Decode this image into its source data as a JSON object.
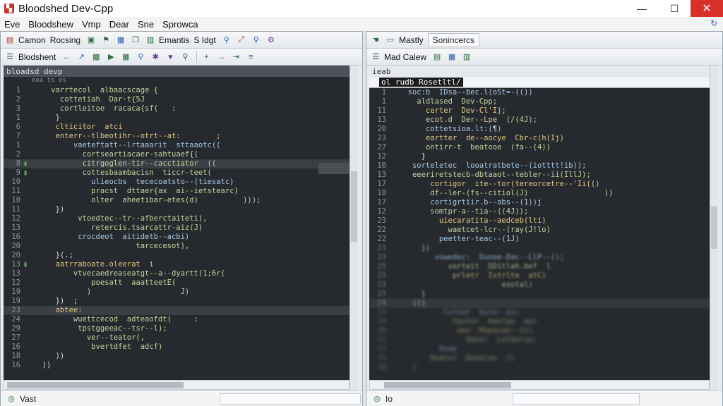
{
  "window": {
    "title": "Bloodshed Dev-Cpp",
    "min": "—",
    "max": "☐",
    "close": "✕"
  },
  "menu": [
    "Eve",
    "Bloodshew",
    "Vmp",
    "Dear",
    "Sne",
    "Sprowca"
  ],
  "left": {
    "toolbar1": {
      "label1": "Camon",
      "label2": "Rocsing",
      "label3": "Emantis",
      "label4": "S Idgt"
    },
    "toolbar2": {
      "label": "Blodshent"
    },
    "editor_title": "bloadsd devp",
    "editor_subtitle": "eoa        ts os",
    "lines": [
      {
        "n": "1",
        "m": "",
        "t": "    varrtecol  albaacscage {",
        "c": "code"
      },
      {
        "n": "2",
        "m": "",
        "t": "      cottetiah  Dar·t{5J",
        "c": "code"
      },
      {
        "n": "3",
        "m": "",
        "t": "      cortleitoe  racaca{sf(   :",
        "c": "code"
      },
      {
        "n": "1",
        "m": "",
        "t": "     }",
        "c": "code"
      },
      {
        "n": "6",
        "m": "",
        "t": "     clticitor  atci",
        "c": "code c3"
      },
      {
        "n": "7",
        "m": "",
        "t": "     enterr--tlbeotihr--otrt--at:        ;",
        "c": "code c3"
      },
      {
        "n": "1",
        "m": "",
        "t": "         vaeteftatt--lrtaaarit  sttaaotc((",
        "c": "code c2"
      },
      {
        "n": "2",
        "m": "",
        "t": "           cortseartiacaer-sahtuaef{(",
        "c": "code"
      },
      {
        "n": "8",
        "m": "▮",
        "t": "           citrgoglen-tir--cacctiator  ((",
        "c": "code"
      },
      {
        "n": "9",
        "m": "▮",
        "t": "           cottesbaambacisn  ticcr-teet(",
        "c": "code"
      },
      {
        "n": "10",
        "m": "",
        "t": "             ulieocbs  tececoatsto--(tiesatc)",
        "c": "code c2"
      },
      {
        "n": "11",
        "m": "",
        "t": "             pracst  dttaer{ax  ai--ietstearc)",
        "c": "code"
      },
      {
        "n": "10",
        "m": "",
        "t": "             olter  aheetibar-etes(d)          )));",
        "c": "code"
      },
      {
        "n": "11",
        "m": "",
        "t": "     })",
        "c": "code c4"
      },
      {
        "n": "12",
        "m": "",
        "t": "          vtoedtec--tr--afberctaiteti),",
        "c": "code"
      },
      {
        "n": "13",
        "m": "",
        "t": "             retercis.tsarcattr-aiz(J)",
        "c": "code"
      },
      {
        "n": "16",
        "m": "",
        "t": "          crocdeot  aitidetb--acbi)",
        "c": "code c2"
      },
      {
        "n": "20",
        "m": "",
        "t": "                       tarcecesot),",
        "c": "code"
      },
      {
        "n": "20",
        "m": "",
        "t": "     }(.;",
        "c": "code c4"
      },
      {
        "n": "13",
        "m": "▮",
        "t": "     aatrraboate.oleerat  i",
        "c": "code c3"
      },
      {
        "n": "13",
        "m": "",
        "t": "         vtvecaedreaseatgt--a--dyartt(1;6r(",
        "c": "code"
      },
      {
        "n": "12",
        "m": "",
        "t": "             poesatt  aaatteetE(",
        "c": "code"
      },
      {
        "n": "19",
        "m": "",
        "t": "            )                    J)",
        "c": "code"
      },
      {
        "n": "19",
        "m": "",
        "t": "     })  ;",
        "c": "code c4"
      },
      {
        "n": "23",
        "m": "",
        "t": "     abtee:",
        "c": "code c3"
      },
      {
        "n": "24",
        "m": "",
        "t": "         wuettcecod  adteaofdt(     :",
        "c": "code"
      },
      {
        "n": "29",
        "m": "",
        "t": "          tpstggeeac--tsr--l);",
        "c": "code"
      },
      {
        "n": "27",
        "m": "",
        "t": "            ver--teator(,",
        "c": "code"
      },
      {
        "n": "16",
        "m": "",
        "t": "             bvertdfet  adcf)",
        "c": "code"
      },
      {
        "n": "18",
        "m": "",
        "t": "     ))",
        "c": "code c4"
      },
      {
        "n": "16",
        "m": "",
        "t": "  ))",
        "c": "code c4"
      }
    ],
    "status": "Vast"
  },
  "right": {
    "toolbar1": {
      "label1": "Mastly",
      "label2": "Sonincercs"
    },
    "toolbar2": {
      "label": "Mad Calew"
    },
    "editor_title": "ieab",
    "editor_sub": "ol   rudb  Rosetltl/",
    "lines": [
      {
        "n": "1",
        "m": "",
        "t": "  soc:b  IDsa--bec.l(oSt=-(())",
        "c": "code c2",
        "b": ""
      },
      {
        "n": "1",
        "m": "",
        "t": "    aldlased  Dev-Cpp;",
        "c": "code",
        "b": ""
      },
      {
        "n": "11",
        "m": "",
        "t": "      certer  Dev-Cl'Ij;",
        "c": "code c3",
        "b": ""
      },
      {
        "n": "13",
        "m": "",
        "t": "      ecot.d  Der--Lpe  (/(4J);",
        "c": "code",
        "b": ""
      },
      {
        "n": "20",
        "m": "",
        "t": "      cottetsioa.lt:(¶)",
        "c": "code c2",
        "b": ""
      },
      {
        "n": "23",
        "m": "",
        "t": "      eartter  de--aocye  Cbr-c(h(Ij)",
        "c": "code c3",
        "b": ""
      },
      {
        "n": "27",
        "m": "",
        "t": "      ontirr-t  beatooe  (fa--(4))",
        "c": "code",
        "b": ""
      },
      {
        "n": "12",
        "m": "",
        "t": "     }",
        "c": "code c4",
        "b": ""
      },
      {
        "n": "10",
        "m": "",
        "t": "   sorteletec  looatratbete--(iotttt!ib));",
        "c": "code c2",
        "b": ""
      },
      {
        "n": "13",
        "m": "",
        "t": "   eeeriretstecb-dbtaaot--tebler--ii(IllJ);",
        "c": "code",
        "b": ""
      },
      {
        "n": "17",
        "m": "",
        "t": "       cortigor  ite--tor(tereorcetre--'Ii(()",
        "c": "code c3",
        "b": ""
      },
      {
        "n": "18",
        "m": "",
        "t": "       df--ler-(fs--citiol(J)                 ))",
        "c": "code",
        "b": ""
      },
      {
        "n": "17",
        "m": "",
        "t": "       cortigrtiir.b--abs--(1))j",
        "c": "code c2",
        "b": ""
      },
      {
        "n": "12",
        "m": "",
        "t": "       somtpr-a--tia--((4J));",
        "c": "code",
        "b": ""
      },
      {
        "n": "23",
        "m": "",
        "t": "         uiecaratita--aedceb(lti)",
        "c": "code c3",
        "b": ""
      },
      {
        "n": "22",
        "m": "",
        "t": "           waetcet-lcr--(ray(J!lo)",
        "c": "code",
        "b": ""
      },
      {
        "n": "22",
        "m": "",
        "t": "         peetter-teac--(1J)",
        "c": "code c2",
        "b": ""
      },
      {
        "n": "23",
        "m": "",
        "t": "     })",
        "c": "code c4",
        "b": "blur"
      },
      {
        "n": "23",
        "m": "",
        "t": "        vowedec:  Dunoe-Dac--LlP--();",
        "c": "code c2",
        "b": "blur"
      },
      {
        "n": "25",
        "m": "",
        "t": "           vorteit  DDitlah.bef  l",
        "c": "code",
        "b": "blur"
      },
      {
        "n": "23",
        "m": "",
        "t": "            prletr  Istrlte  atC)",
        "c": "code c3",
        "b": "blur"
      },
      {
        "n": "23",
        "m": "",
        "t": "                       exotal)",
        "c": "code",
        "b": "blur"
      },
      {
        "n": "23",
        "m": "",
        "t": "     }",
        "c": "code c4",
        "b": "blur"
      },
      {
        "n": "24",
        "m": "",
        "t": "   (()",
        "c": "code c4",
        "b": "blur"
      },
      {
        "n": "25",
        "m": "",
        "t": "          Cuteat  buto--eu)",
        "c": "code c2",
        "b": "blur2"
      },
      {
        "n": "29",
        "m": "",
        "t": "            Ceuter  Aastau  aor",
        "c": "code",
        "b": "blur2"
      },
      {
        "n": "28",
        "m": "",
        "t": "             meo  Mnpacan--ti)",
        "c": "code c3",
        "b": "blur2"
      },
      {
        "n": "23",
        "m": "",
        "t": "               bbnor  Lotboruo:",
        "c": "code",
        "b": "blur2"
      },
      {
        "n": "23",
        "m": "",
        "t": "         Deao",
        "c": "code c2",
        "b": "blur2"
      },
      {
        "n": "15",
        "m": "",
        "t": "       Doatur  Deealou  ()",
        "c": "code",
        "b": "blur2"
      },
      {
        "n": "10",
        "m": "",
        "t": "   )",
        "c": "code c4",
        "b": "blur2"
      }
    ],
    "status": "Io"
  }
}
